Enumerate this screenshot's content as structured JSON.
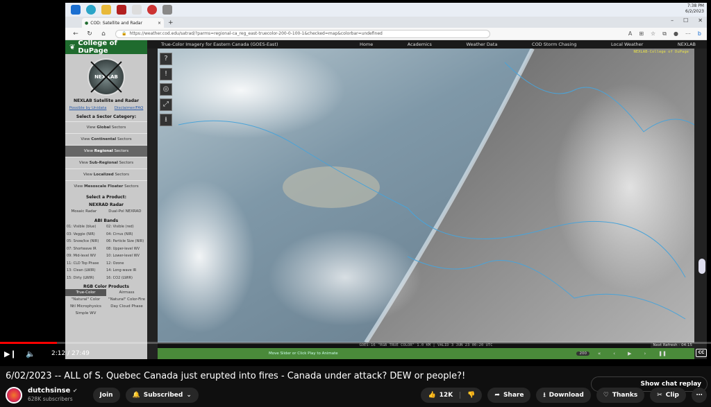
{
  "taskbar": {
    "time": "7:38 PM",
    "date": "6/2/2023"
  },
  "browser": {
    "tab_title": "COD: Satellite and Radar",
    "url": "https://weather.cod.edu/satrad/?parms=regional-ca_reg_east-truecolor-200-0-100-1&checked=map&colorbar=undefined"
  },
  "site": {
    "logo": "College of DuPage",
    "nexlab": "NEX LAB",
    "title": "NEXLAB Satellite and Radar",
    "link_left": "Possible by Unidata",
    "link_right": "Disclaimer/FAQ",
    "sector_heading": "Select a Sector Category:",
    "sectors": [
      {
        "prefix": "View ",
        "bold": "Global",
        "suffix": " Sectors"
      },
      {
        "prefix": "View ",
        "bold": "Continental",
        "suffix": " Sectors"
      },
      {
        "prefix": "View ",
        "bold": "Regional",
        "suffix": " Sectors"
      },
      {
        "prefix": "View ",
        "bold": "Sub-Regional",
        "suffix": " Sectors"
      },
      {
        "prefix": "View ",
        "bold": "Localized",
        "suffix": " Sectors"
      },
      {
        "prefix": "View ",
        "bold": "Mesoscale Floater",
        "suffix": " Sectors"
      }
    ],
    "product_heading": "Select a Product:",
    "nexrad_heading": "NEXRAD Radar",
    "nexrad_left": "Mosaic Radar",
    "nexrad_right": "Dual-Pol NEXRAD",
    "abi_heading": "ABI Bands",
    "bands": [
      "01: Visible (blue)",
      "02: Visible (red)",
      "03: Veggie (NIR)",
      "04: Cirrus (NIR)",
      "05: Snow/Ice (NIR)",
      "06: Particle Size (NIR)",
      "07: Shortwave IR",
      "08: Upper-level WV",
      "09: Mid-level WV",
      "10: Lower-level WV",
      "11: CLD Top Phase",
      "12: Ozone",
      "13: Clean (LWIR)",
      "14: Long-wave IR",
      "15: Dirty (LWIR)",
      "16: CO2 (LWIR)"
    ],
    "rgb_heading": "RGB Color Products",
    "rgb_row1": [
      "True-Color",
      "Airmass"
    ],
    "rgb_row2": [
      "\"Natural\" Color",
      "\"Natural\" Color-Fire"
    ],
    "rgb_row3": [
      "Ntl Microphysics",
      "Day Cloud Phase"
    ],
    "rgb_row4": [
      "Simple WV",
      ""
    ]
  },
  "map": {
    "title": "True-Color Imagery for Eastern Canada (GOES-East)",
    "nav": [
      "Home",
      "Academics",
      "Weather Data",
      "COD Storm Chasing",
      "Local Weather",
      "NEXLAB"
    ],
    "brand": "NEXLAB-College of DuPage",
    "status": "GOES-16 \"RGB TRUE COLOR\" 1.0 KM | VALID 3 JUN 23 00:20 UTC",
    "refresh": "Next Refresh - 04:15",
    "hint": "Move Slider or Click Play to Animate",
    "speed": "200",
    "tool_icons": [
      "?",
      "!",
      "◎",
      "⤢",
      "⭳"
    ]
  },
  "player": {
    "time": "2:12 / 27:49",
    "progress_fraction": 0.08,
    "cc": "CC"
  },
  "video": {
    "title": "6/02/2023 -- ALL of S. Quebec Canada just erupted into fires - Canada under attack? DEW or people?!",
    "chat_replay": "Show chat replay",
    "channel": "dutchsinse",
    "subscribers": "628K subscribers",
    "join": "Join",
    "subscribed": "Subscribed",
    "likes": "12K",
    "share": "Share",
    "download": "Download",
    "thanks": "Thanks",
    "clip": "Clip",
    "more": "⋯"
  },
  "colors": {
    "cod_green": "#1f6b2e",
    "progress": "#ff0000",
    "brand_yellow": "#e9e24a"
  }
}
